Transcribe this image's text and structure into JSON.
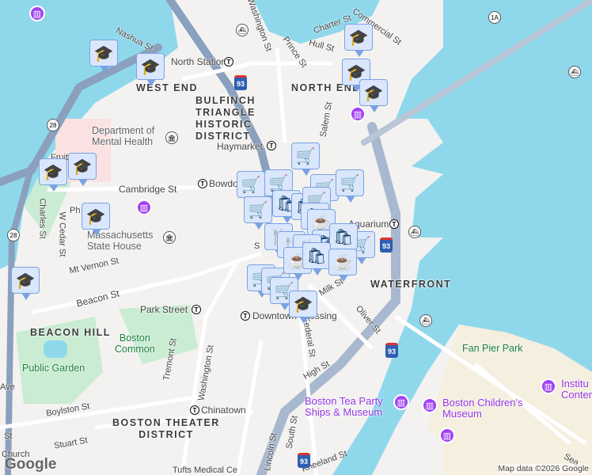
{
  "labels": {
    "west_end": "WEST END",
    "bulfinch": "BULFINCH\nTRIANGLE\nHISTORIC\nDISTRICT",
    "north_end": "NORTH END",
    "waterfront": "WATERFRONT",
    "beacon_hill": "BEACON HILL",
    "theater": "BOSTON THEATER\nDISTRICT",
    "dmh": "Department of\nMental Health",
    "state_house": "Massachusetts\nState House",
    "common": "Boston\nCommon",
    "public_garden": "Public Garden",
    "fan_pier": "Fan Pier Park",
    "tea_party": "Boston Tea Party\nShips & Museum",
    "childrens": "Boston Children's\nMuseum",
    "institute": "Institu\nConter",
    "north_station": "North Station",
    "haymarket": "Haymarket",
    "bowdoin": "Bowdoin",
    "aquarium": "Aquarium",
    "park_street": "Park Street",
    "downtown": "Downtown Crossing",
    "chinatown": "Chinatown",
    "nashua": "Nashua St",
    "washington_n": "Washington St",
    "prince": "Prince St",
    "hull": "Hull St",
    "charter": "Charter St",
    "commercial": "Commercial St",
    "salem": "Salem St",
    "cambridge": "Cambridge St",
    "charles": "Charles St",
    "wcedar": "W Cedar St",
    "mtvernon": "Mt Vernon St",
    "beacon": "Beacon St",
    "tremont": "Tremont St",
    "washington_s": "Washington St",
    "federal": "Federal St",
    "high": "High St",
    "oliver": "Oliver St",
    "milk": "Milk St",
    "boylston": "Boylston St",
    "stuart": "Stuart St",
    "lincoln": "Lincoln St",
    "south": "South St",
    "kneeland": "Kneeland St",
    "ave": "Ave",
    "st_left": "St",
    "church": "Church",
    "tufts": "Tufts Medical Ce",
    "sea": "Sea",
    "fruit": "Fruit",
    "ph": "Ph",
    "state": "S"
  },
  "shields": {
    "i93": "93",
    "r28": "28",
    "r1a": "1A"
  },
  "markers": {
    "school": "school-icon",
    "cart": "shopping-cart-icon",
    "restaurant": "restaurant-icon",
    "cafe": "cafe-icon",
    "shop": "shopping-bag-icon"
  },
  "attribution": "Map data ©2026 Google",
  "logo": "Google"
}
